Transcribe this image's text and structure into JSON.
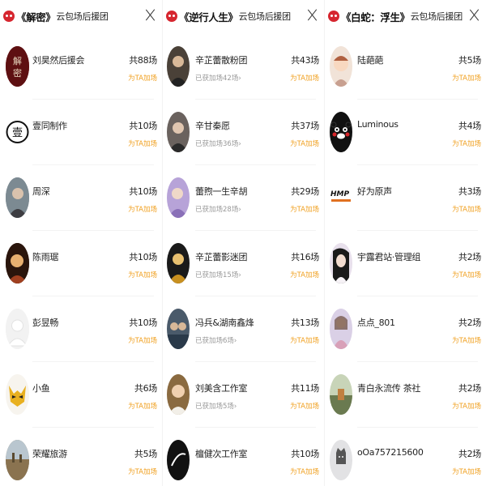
{
  "add_label": "为TA加场",
  "columns": [
    {
      "title": "《解密》",
      "subtitle": "云包场后援团",
      "items": [
        {
          "name": "刘昊然后援会",
          "count": "共88场",
          "sub": "",
          "avatar": {
            "bg": "#7a1518",
            "text": "解密",
            "icon": "poster-icon"
          }
        },
        {
          "name": "壹同制作",
          "count": "共10场",
          "sub": "",
          "avatar": {
            "bg": "#ffffff",
            "text": "壹",
            "icon": "yi-logo-icon"
          }
        },
        {
          "name": "周深",
          "count": "共10场",
          "sub": "",
          "avatar": {
            "bg": "#6f7d86",
            "text": "",
            "icon": "photo-icon"
          }
        },
        {
          "name": "陈雨琚",
          "count": "共10场",
          "sub": "",
          "avatar": {
            "bg": "#3a1f12",
            "text": "",
            "icon": "photo-icon"
          }
        },
        {
          "name": "彭昱畅",
          "count": "共10场",
          "sub": "",
          "avatar": {
            "bg": "#eeeeee",
            "text": "",
            "icon": "default-avatar-icon"
          }
        },
        {
          "name": "小鱼",
          "count": "共6场",
          "sub": "",
          "avatar": {
            "bg": "#ffffff",
            "text": "",
            "icon": "wolverine-mask-icon"
          }
        },
        {
          "name": "荣耀旅游",
          "count": "共5场",
          "sub": "",
          "avatar": {
            "bg": "#8a7a5a",
            "text": "",
            "icon": "photo-icon"
          }
        }
      ]
    },
    {
      "title": "《逆行人生》",
      "subtitle": "云包场后援团",
      "items": [
        {
          "name": "辛芷蕾散粉团",
          "count": "共43场",
          "sub": "已获加场42场›",
          "avatar": {
            "bg": "#4a4138",
            "text": "",
            "icon": "photo-icon"
          }
        },
        {
          "name": "辛甘秦愿",
          "count": "共37场",
          "sub": "已获加场36场›",
          "avatar": {
            "bg": "#5b5350",
            "text": "",
            "icon": "photo-icon"
          }
        },
        {
          "name": "蕾煦一生辛胡",
          "count": "共29场",
          "sub": "已获加场28场›",
          "avatar": {
            "bg": "#b7a3d8",
            "text": "",
            "icon": "photo-icon"
          }
        },
        {
          "name": "辛芷蕾影迷团",
          "count": "共16场",
          "sub": "已获加场15场›",
          "avatar": {
            "bg": "#1a1a1a",
            "text": "",
            "icon": "photo-icon"
          }
        },
        {
          "name": "冯兵&湖南鑫烽",
          "count": "共13场",
          "sub": "已获加场6场›",
          "avatar": {
            "bg": "#4a5a6a",
            "text": "",
            "icon": "photo-icon"
          }
        },
        {
          "name": "刘美含工作室",
          "count": "共11场",
          "sub": "已获加场5场›",
          "avatar": {
            "bg": "#8a6a40",
            "text": "",
            "icon": "photo-icon"
          }
        },
        {
          "name": "檀健次工作室",
          "count": "共10场",
          "sub": "",
          "avatar": {
            "bg": "#111111",
            "text": "",
            "icon": "studio-logo-icon"
          }
        }
      ]
    },
    {
      "title": "《白蛇：浮生》",
      "subtitle": "云包场后援团",
      "items": [
        {
          "name": "陆葩葩",
          "count": "共5场",
          "sub": "",
          "avatar": {
            "bg": "#f1e3d8",
            "text": "",
            "icon": "cartoon-icon"
          }
        },
        {
          "name": "Luminous",
          "count": "共4场",
          "sub": "",
          "avatar": {
            "bg": "#111111",
            "text": "",
            "icon": "kumamon-icon"
          }
        },
        {
          "name": "好为原声",
          "count": "共3场",
          "sub": "",
          "avatar": {
            "bg": "#ffffff",
            "text": "HMP",
            "icon": "hmp-logo-icon"
          }
        },
        {
          "name": "宇露君站·管理组",
          "count": "共2场",
          "sub": "",
          "avatar": {
            "bg": "#e8e0ec",
            "text": "",
            "icon": "photo-icon"
          }
        },
        {
          "name": "点点_801",
          "count": "共2场",
          "sub": "",
          "avatar": {
            "bg": "#dad0e6",
            "text": "",
            "icon": "photo-icon"
          }
        },
        {
          "name": "青白永流传 茶社",
          "count": "共2场",
          "sub": "",
          "avatar": {
            "bg": "#8a9a70",
            "text": "",
            "icon": "photo-icon"
          }
        },
        {
          "name": "oOa757215600",
          "count": "共2场",
          "sub": "",
          "avatar": {
            "bg": "#e2e2e4",
            "text": "",
            "icon": "default-avatar-icon"
          }
        }
      ]
    }
  ]
}
